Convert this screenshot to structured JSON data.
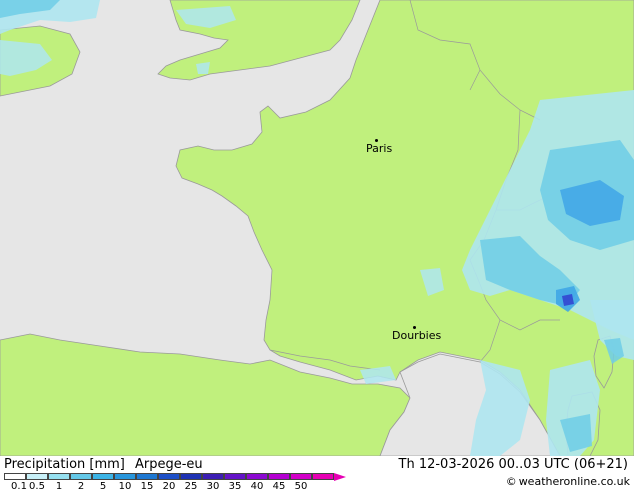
{
  "map": {
    "colors": {
      "sea": "#e6e6e6",
      "land": "#c0f07d",
      "border": "#9a9a9a",
      "precip_light": "#aee6f0",
      "precip_mid": "#6fcce6",
      "precip_heavy": "#3fa6e6",
      "precip_peak": "#3246d0"
    },
    "cities": [
      {
        "name": "Paris"
      },
      {
        "name": "Dourbies"
      }
    ]
  },
  "legend": {
    "title": "Precipitation [mm]",
    "model": "Arpege-eu",
    "validity": "Th 12-03-2026 00..03 UTC (06+21)",
    "credit": "weatheronline.co.uk",
    "colorbar": {
      "colors": [
        "#ffffff",
        "#c8f0f8",
        "#96e0f0",
        "#64c8e8",
        "#3cb4e6",
        "#2896dc",
        "#1e78d2",
        "#1e50c8",
        "#1e32b4",
        "#3c1eb4",
        "#6414c8",
        "#8c0ad2",
        "#b400d2",
        "#d200c8",
        "#e600b4"
      ],
      "arrow_color": "#e600b4",
      "ticks": [
        "0.1",
        "0.5",
        "1",
        "2",
        "5",
        "10",
        "15",
        "20",
        "25",
        "30",
        "35",
        "40",
        "45",
        "50"
      ]
    }
  }
}
